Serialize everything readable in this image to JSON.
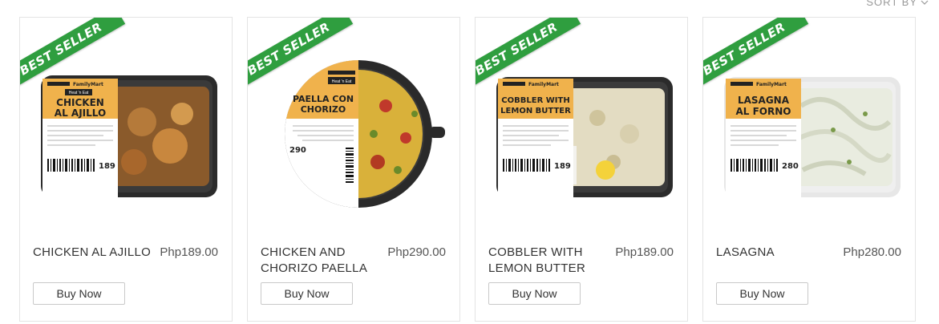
{
  "sort": {
    "label": "SORT BY",
    "icon": "chevron-down-icon"
  },
  "badge": {
    "text": "BEST SELLER",
    "color": "#2f9e3f"
  },
  "brand": {
    "store": "FamilyMart",
    "line": "Heat 'n Eat"
  },
  "products": [
    {
      "name": "CHICKEN AL AJILLO",
      "price": "Php189.00",
      "button": "Buy Now",
      "label_lines": [
        "CHICKEN",
        "AL AJILLO"
      ],
      "label_price": "189",
      "photo_style": "tray-brown"
    },
    {
      "name": "CHICKEN AND CHORIZO PAELLA",
      "price": "Php290.00",
      "button": "Buy Now",
      "label_lines": [
        "PAELLA CON",
        "CHORIZO"
      ],
      "label_price": "290",
      "photo_style": "pan-yellow"
    },
    {
      "name": "COBBLER WITH LEMON BUTTER",
      "price": "Php189.00",
      "button": "Buy Now",
      "label_lines": [
        "COBBLER WITH",
        "LEMON BUTTER"
      ],
      "label_price": "189",
      "photo_style": "tray-cream"
    },
    {
      "name": "LASAGNA",
      "price": "Php280.00",
      "button": "Buy Now",
      "label_lines": [
        "LASAGNA",
        "AL FORNO"
      ],
      "label_price": "280",
      "photo_style": "tray-white"
    }
  ]
}
